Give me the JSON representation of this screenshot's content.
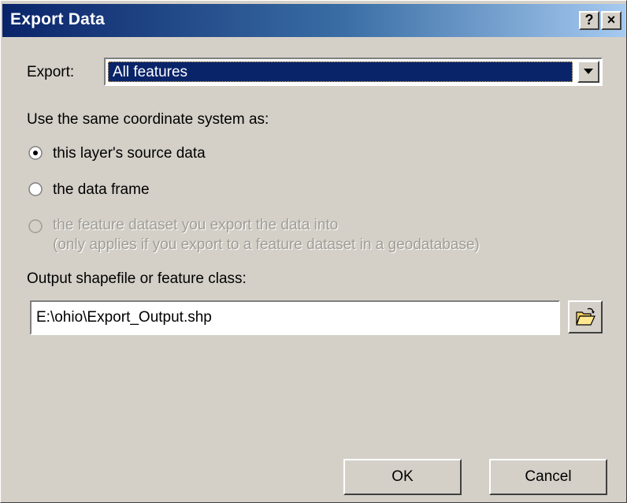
{
  "window": {
    "title": "Export Data",
    "help_label": "?",
    "close_label": "×"
  },
  "export": {
    "label": "Export:",
    "selected": "All features"
  },
  "coordinate": {
    "heading": "Use the same coordinate system as:",
    "options": [
      {
        "label": "this layer's source data",
        "selected": true,
        "enabled": true
      },
      {
        "label": "the data frame",
        "selected": false,
        "enabled": true
      },
      {
        "label": "the feature dataset you export the data into",
        "selected": false,
        "enabled": false
      }
    ],
    "note": "(only applies if you export to a feature dataset in a geodatabase)"
  },
  "output": {
    "label": "Output shapefile or feature class:",
    "value": "E:\\ohio\\Export_Output.shp"
  },
  "buttons": {
    "ok": "OK",
    "cancel": "Cancel"
  },
  "icons": {
    "dropdown": "chevron-down-icon",
    "browse": "open-folder-icon"
  },
  "colors": {
    "title_start": "#0a246a",
    "title_end": "#a6caf0",
    "face": "#d4d0c8",
    "selection": "#0a246a"
  }
}
